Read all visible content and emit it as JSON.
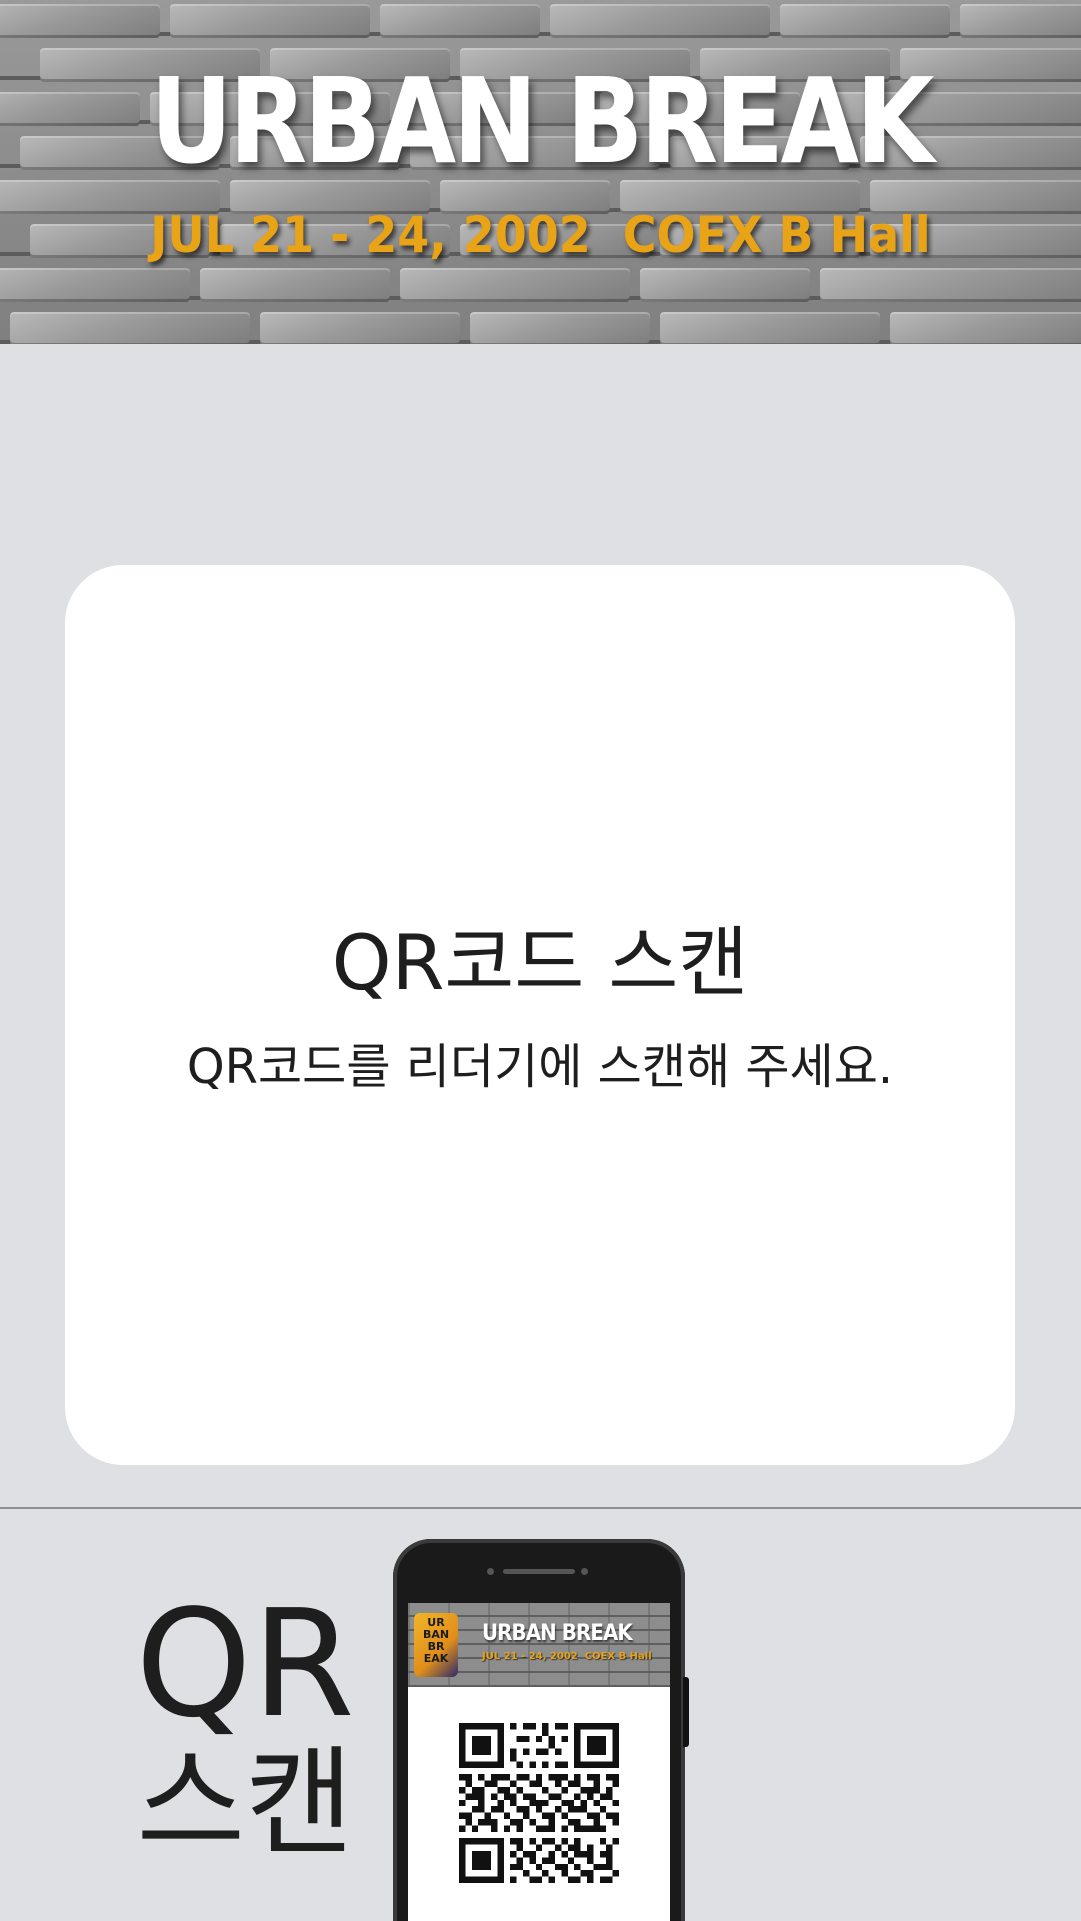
{
  "banner": {
    "title": "URBAN BREAK",
    "subtitle": "JUL 21 - 24, 2002  COEX B Hall",
    "title_color": "#ffffff",
    "subtitle_color": "#e8a317",
    "background": "stone-wall"
  },
  "card": {
    "title": "QR코드 스캔",
    "message": "QR코드를 리더기에 스캔해 주세요."
  },
  "hint": {
    "line1": "QR",
    "line2": "스캔"
  },
  "phone": {
    "logo_text": "UR BAN BR EAK",
    "title": "URBAN BREAK",
    "subtitle": "JUL 21 - 24, 2002  COEX B Hall",
    "icon": "qr-code-icon"
  },
  "colors": {
    "background": "#dfe0e4",
    "card": "#ffffff",
    "text": "#1e1e1e",
    "divider": "#8e8f93"
  }
}
